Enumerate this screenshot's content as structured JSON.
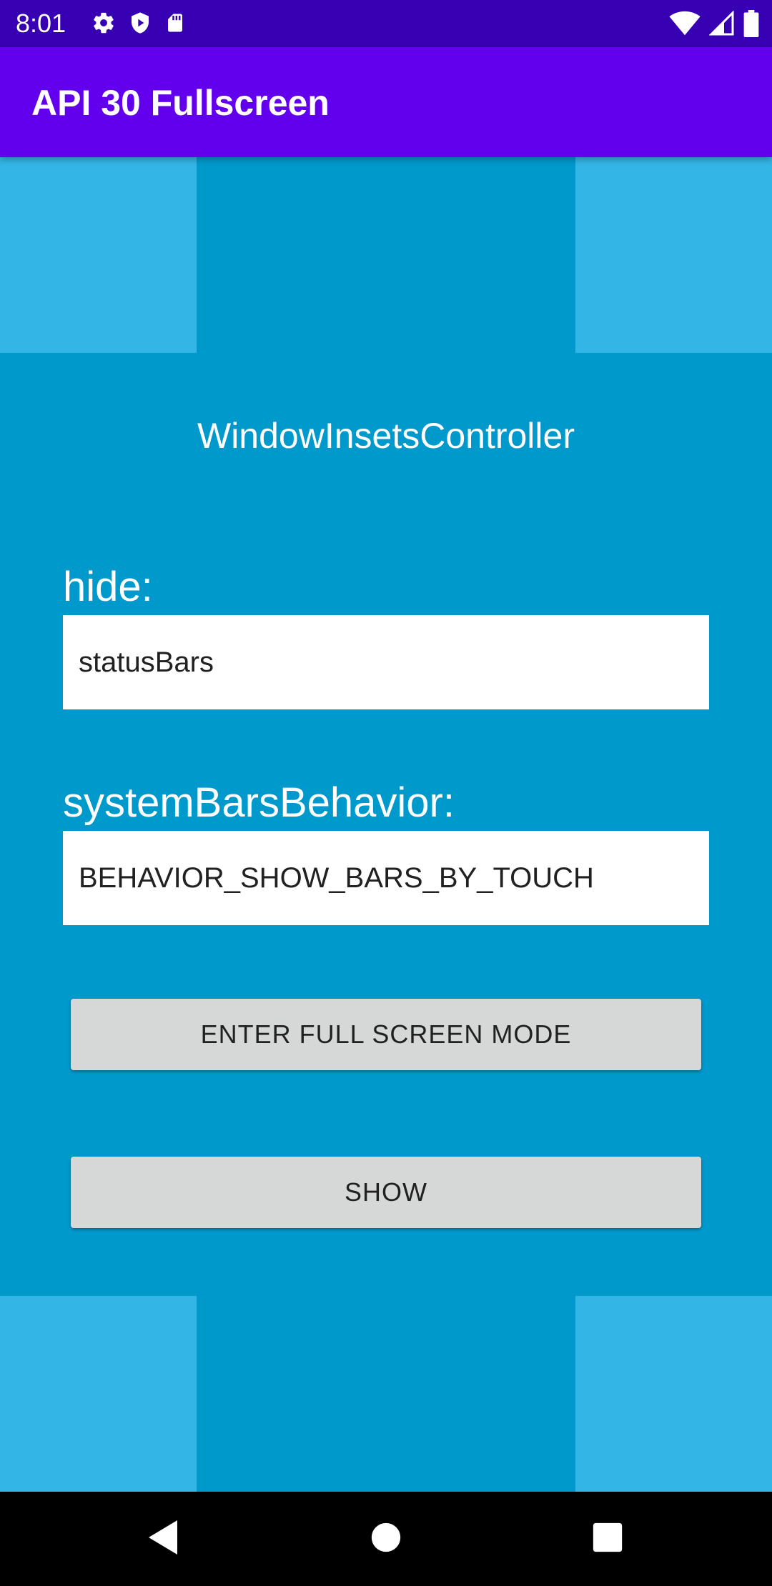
{
  "status_bar": {
    "time": "8:01",
    "icons_left": [
      "gear-icon",
      "shield-icon",
      "sd-card-icon"
    ],
    "icons_right": [
      "wifi-icon",
      "cell-signal-icon",
      "battery-icon"
    ]
  },
  "app_bar": {
    "title": "API 30 Fullscreen"
  },
  "main": {
    "heading": "WindowInsetsController",
    "hide_label": "hide:",
    "hide_value": "statusBars",
    "behavior_label": "systemBarsBehavior:",
    "behavior_value": "BEHAVIOR_SHOW_BARS_BY_TOUCH",
    "enter_button": "ENTER FULL SCREEN MODE",
    "show_button": "SHOW"
  },
  "nav_bar": {
    "buttons": [
      "back-icon",
      "home-icon",
      "recents-icon"
    ]
  },
  "colors": {
    "status_bar": "#3700B3",
    "app_bar": "#6200EE",
    "content_bg": "#0099CC",
    "corner_blocks": "#33B5E5",
    "button_bg": "#D6D7D7"
  }
}
